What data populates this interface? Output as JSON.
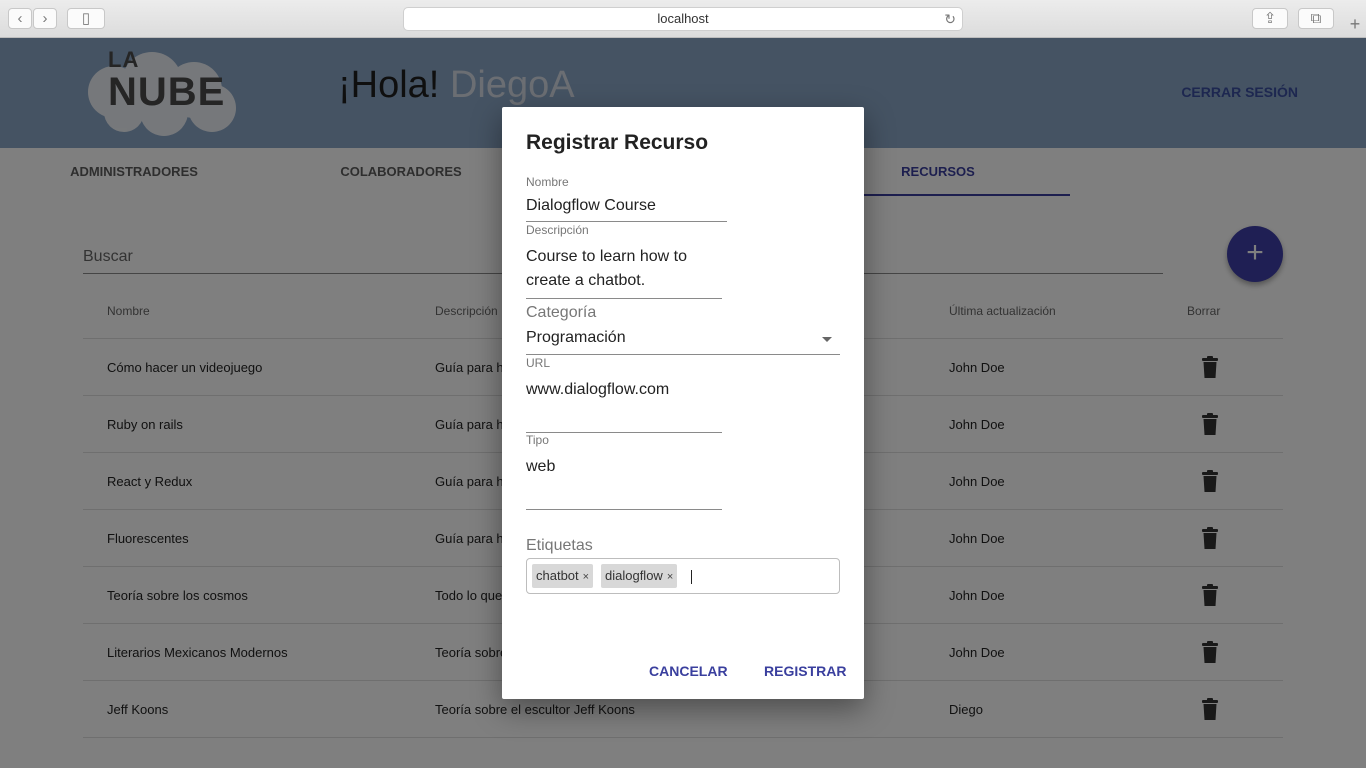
{
  "browser": {
    "url": "localhost",
    "back_icon": "chevron-left-icon",
    "forward_icon": "chevron-right-icon"
  },
  "header": {
    "logo_la": "LA",
    "logo_nube": "NUBE",
    "greeting": "¡Hola!",
    "username": "DiegoA",
    "logout": "CERRAR SESIÓN",
    "colors": {
      "bg": "#8ba6c6",
      "accent": "#3a3f9e"
    }
  },
  "tabs": [
    {
      "label": "ADMINISTRADORES",
      "active": false
    },
    {
      "label": "COLABORADORES",
      "active": false
    },
    {
      "label": "RECURSOS",
      "active": true
    }
  ],
  "search": {
    "placeholder": "Buscar"
  },
  "table": {
    "headers": [
      "Nombre",
      "Descripción",
      "Última actualización",
      "Borrar"
    ],
    "rows": [
      {
        "name": "Cómo hacer un videojuego",
        "desc": "Guía para ha",
        "updated": "John Doe"
      },
      {
        "name": "Ruby on rails",
        "desc": "Guía para ha",
        "updated": "John Doe"
      },
      {
        "name": "React y Redux",
        "desc": "Guía para ha",
        "updated": "John Doe"
      },
      {
        "name": "Fluorescentes",
        "desc": "Guía para ha",
        "updated": "John Doe"
      },
      {
        "name": "Teoría sobre los cosmos",
        "desc": "Todo lo que",
        "updated": "John Doe"
      },
      {
        "name": "Literarios Mexicanos Modernos",
        "desc": "Teoría sobre",
        "updated": "John Doe"
      },
      {
        "name": "Jeff Koons",
        "desc": "Teoría sobre el escultor Jeff Koons",
        "updated": "Diego"
      }
    ]
  },
  "dialog": {
    "title": "Registrar Recurso",
    "name_label": "Nombre",
    "name_value": "Dialogflow Course",
    "desc_label": "Descripción",
    "desc_line1": "Course to learn how to",
    "desc_line2": "create a chatbot.",
    "category_label": "Categoría",
    "category_value": "Programación",
    "url_label": "URL",
    "url_value": "www.dialogflow.com",
    "type_label": "Tipo",
    "type_value": "web",
    "tags_label": "Etiquetas",
    "tags": [
      "chatbot",
      "dialogflow"
    ],
    "tag_remove": "×",
    "cancel": "CANCELAR",
    "submit": "REGISTRAR"
  }
}
